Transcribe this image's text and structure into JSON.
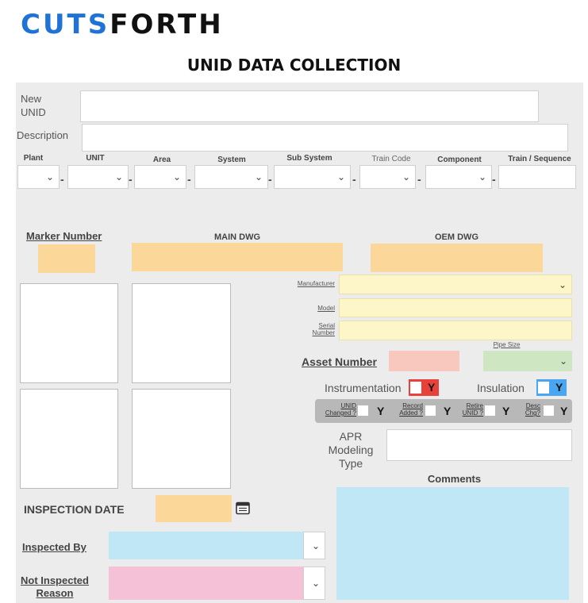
{
  "header": {
    "logo_part1": "CUTS",
    "logo_part2": "FORTH",
    "title": "UNID DATA COLLECTION"
  },
  "fields": {
    "new_unid_label": "New\nUNID",
    "description_label": "Description"
  },
  "columns": [
    {
      "label": "Plant"
    },
    {
      "label": "UNIT"
    },
    {
      "label": "Area"
    },
    {
      "label": "System"
    },
    {
      "label": "Sub System"
    },
    {
      "label": "Train Code"
    },
    {
      "label": "Component"
    },
    {
      "label": "Train / Sequence"
    }
  ],
  "drawing": {
    "marker_number_label": "Marker Number",
    "main_dwg_label": "MAIN DWG",
    "oem_dwg_label": "OEM DWG"
  },
  "asset": {
    "manufacturer_label": "Manufacturer",
    "model_label": "Model",
    "serial_label": "Serial\nNumber",
    "pipe_size_label": "Pipe Size",
    "asset_number_label": "Asset Number",
    "instrumentation_label": "Instrumentation",
    "insulation_label": "Insulation",
    "yes_mark": "Y"
  },
  "flags": [
    {
      "label": "UNID\nChanged ?"
    },
    {
      "label": "Record\nAdded ?"
    },
    {
      "label": "Retire\nUNID ?"
    },
    {
      "label": "Desc\nChg?"
    }
  ],
  "apr": {
    "label": "APR\nModeling\nType"
  },
  "comments": {
    "label": "Comments"
  },
  "inspection": {
    "date_label": "INSPECTION DATE",
    "inspected_by_label": "Inspected By",
    "not_inspected_label": "Not Inspected\nReason"
  },
  "icons": {
    "dropdown": "chevron-down-icon",
    "calendar": "calendar-icon"
  },
  "colors": {
    "logo_accent": "#1f73d6",
    "required_orange": "#fbd79a",
    "equipment_yellow": "#fdf6c8",
    "asset_pink": "#f8c8bf",
    "pipe_green": "#cfe6c2",
    "comments_blue": "#bfe7f6",
    "reason_rose": "#f4c1d6",
    "instrumentation_red": "#e8413a",
    "insulation_blue": "#4aa6f0"
  }
}
